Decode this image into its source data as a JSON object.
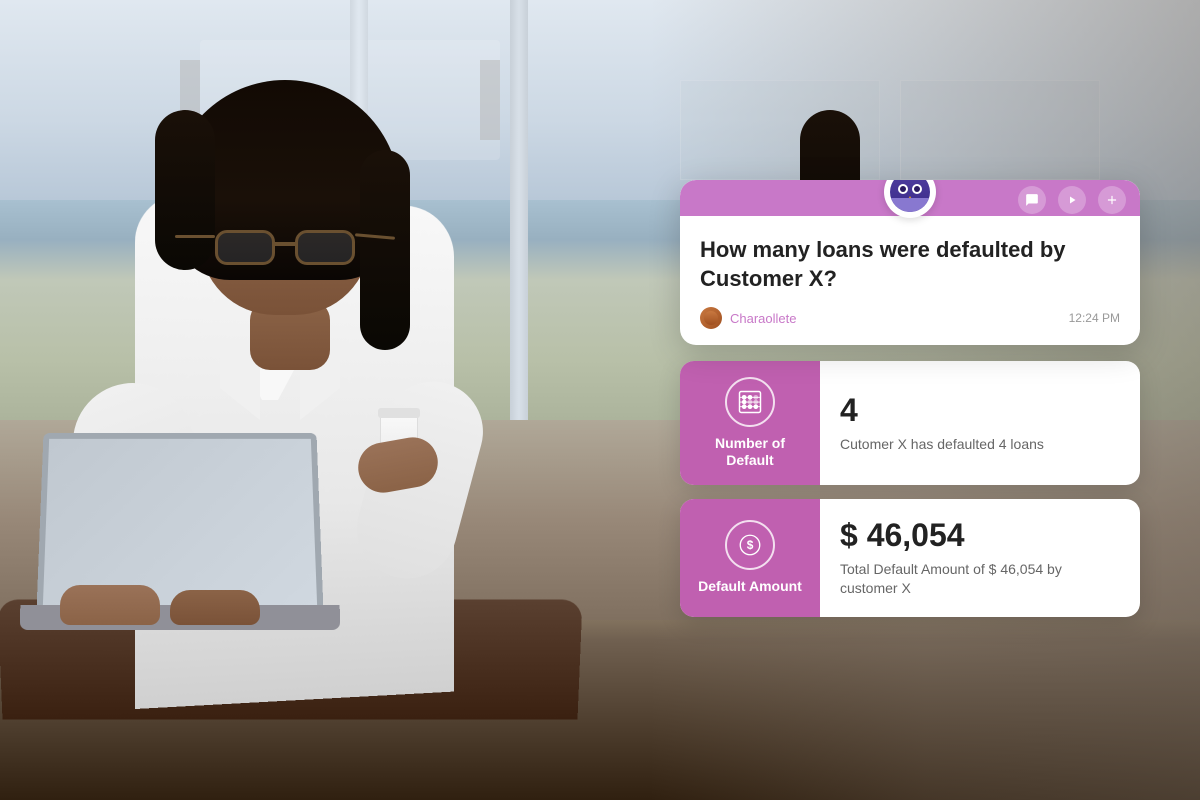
{
  "background": {
    "alt": "Woman working on laptop in modern office atrium"
  },
  "chat_card": {
    "owl_emoji": "🦉",
    "question": "How many loans were defaulted by Customer X?",
    "username": "Charaollete",
    "time": "12:24 PM",
    "actions": {
      "chat_icon": "💬",
      "play_icon": "▶",
      "plus_icon": "+"
    }
  },
  "metric_cards": [
    {
      "id": "number_of_default",
      "label": "Number of Default",
      "icon_type": "abacus",
      "value": "4",
      "description": "Cutomer X has defaulted 4 loans"
    },
    {
      "id": "default_amount",
      "label": "Default Amount",
      "icon_type": "dollar",
      "value": "$ 46,054",
      "description": "Total Default Amount of $ 46,054 by customer X"
    }
  ],
  "colors": {
    "purple_accent": "#c060b0",
    "purple_light": "#c878c8",
    "white": "#ffffff",
    "text_dark": "#222222",
    "text_muted": "#666666",
    "username_color": "#c060b0"
  }
}
